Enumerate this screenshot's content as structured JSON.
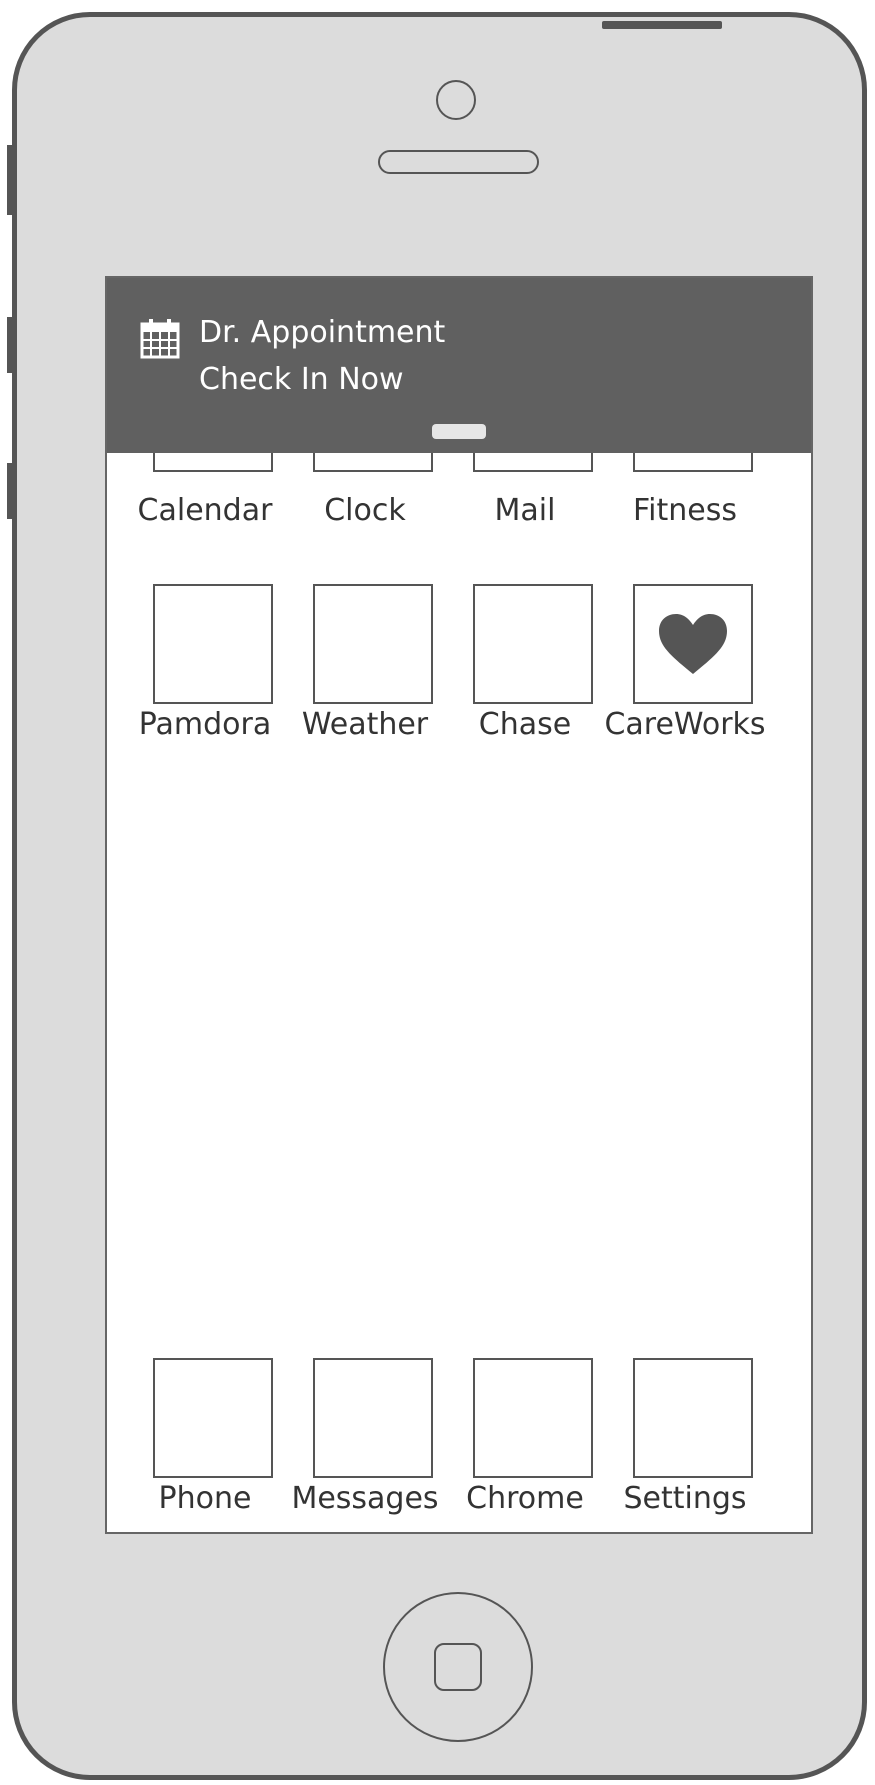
{
  "notification": {
    "title": "Dr. Appointment",
    "subtitle": "Check In Now",
    "icon": "calendar-icon"
  },
  "apps_row1": [
    "Calendar",
    "Clock",
    "Mail",
    "Fitness"
  ],
  "apps_row2": [
    "Pamdora",
    "Weather",
    "Chase",
    "CareWorks"
  ],
  "dock": [
    "Phone",
    "Messages",
    "Chrome",
    "Settings"
  ],
  "careworks_icon": "heart-icon",
  "colors": {
    "frame": "#dcdcdc",
    "outline": "#555555",
    "notification_bg": "#606060"
  }
}
